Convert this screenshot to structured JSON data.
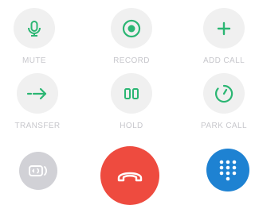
{
  "buttons": [
    {
      "label": "MUTE",
      "icon": "microphone-icon"
    },
    {
      "label": "RECORD",
      "icon": "record-icon"
    },
    {
      "label": "ADD CALL",
      "icon": "plus-icon"
    },
    {
      "label": "TRANSFER",
      "icon": "arrow-right-icon"
    },
    {
      "label": "HOLD",
      "icon": "pause-icon"
    },
    {
      "label": "PARK CALL",
      "icon": "timer-icon"
    }
  ],
  "bottom": {
    "speaker": {
      "icon": "speaker-icon"
    },
    "end_call": {
      "icon": "hang-up-icon"
    },
    "keypad": {
      "icon": "keypad-icon"
    }
  },
  "colors": {
    "accent": "#2bb673",
    "circle_bg": "#f0f0f0",
    "label": "#c7c7cc",
    "end_call": "#ee4b3f",
    "keypad": "#1e82d2",
    "speaker_bg": "#d1d1d6"
  }
}
